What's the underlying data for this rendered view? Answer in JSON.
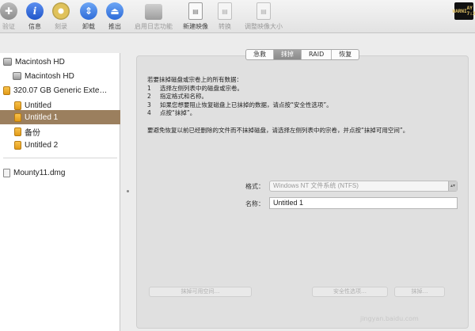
{
  "toolbar": {
    "verify": "验证",
    "info": "信息",
    "burn": "刻录",
    "unmount": "卸载",
    "eject": "推出",
    "enable_journaling": "启用日志功能",
    "new_image": "新建映像",
    "convert": "转换",
    "resize_image": "调整映像大小",
    "log_icon_text": [
      "WARNI",
      "AY 7:3"
    ]
  },
  "sidebar": {
    "items": [
      {
        "label": "Macintosh HD",
        "icon": "disk-icon"
      },
      {
        "label": "Macintosh HD",
        "icon": "disk-icon"
      },
      {
        "label": "320.07 GB Generic Exte…",
        "icon": "external-drive-icon"
      },
      {
        "label": "Untitled",
        "icon": "volume-icon"
      },
      {
        "label": "Untitled 1",
        "icon": "volume-icon",
        "selected": true
      },
      {
        "label": "备份",
        "icon": "volume-icon"
      },
      {
        "label": "Untitled 2",
        "icon": "volume-icon"
      },
      {
        "label": "Mounty11.dmg",
        "icon": "disk-image-icon"
      }
    ]
  },
  "tabs": [
    "急救",
    "抹掉",
    "RAID",
    "恢复"
  ],
  "active_tab": "抹掉",
  "instructions": {
    "intro": "若要抹掉磁盘或宗卷上的所有数据：",
    "steps": [
      {
        "num": "1",
        "text": "选择左侧列表中的磁盘或宗卷。"
      },
      {
        "num": "2",
        "text": "指定格式和名称。"
      },
      {
        "num": "3",
        "text": "如果您想要阻止恢复磁盘上已抹掉的数据，请点按“安全性选项”。"
      },
      {
        "num": "4",
        "text": "点按“抹掉”。"
      }
    ],
    "note": "要避免恢复以前已经删除的文件而不抹掉磁盘，请选择左侧列表中的宗卷，并点按“抹掉可用空间”。"
  },
  "form": {
    "format_label": "格式：",
    "format_value": "Windows NT 文件系统 (NTFS)",
    "name_label": "名称：",
    "name_value": "Untitled 1"
  },
  "buttons": {
    "erase_free_space": "抹掉可用空间…",
    "security_options": "安全性选项…",
    "erase": "抹掉…"
  },
  "watermark": "jingyan.baidu.com",
  "colors": {
    "selection": "#9b7f5e",
    "active_tab": "#8a8a8a",
    "info_blue": "#1f55c9"
  }
}
